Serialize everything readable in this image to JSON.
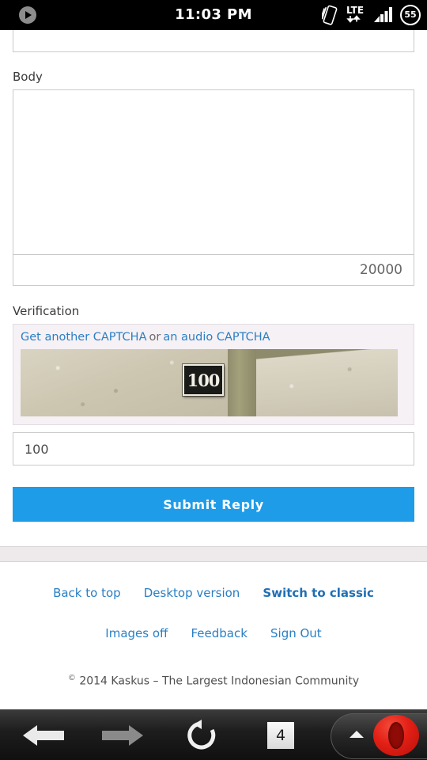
{
  "status_bar": {
    "play_icon": "play-circle-icon",
    "clock": "11:03 PM",
    "vibrate_icon": "vibrate-phone-icon",
    "network_label": "LTE",
    "data_arrows_icon": "data-transfer-arrows-icon",
    "signal_icon": "signal-bars-icon",
    "battery_level": "55"
  },
  "form": {
    "body_label": "Body",
    "body_value": "",
    "body_placeholder": "",
    "char_counter": "20000",
    "verification_label": "Verification",
    "captcha": {
      "get_another_link": "Get another CAPTCHA",
      "separator_text": "or",
      "audio_link": "an audio CAPTCHA",
      "image_alt": "captcha-street-number-photo",
      "image_number": "100"
    },
    "captcha_answer_value": "100",
    "captcha_answer_placeholder": "",
    "submit_label": "Submit Reply"
  },
  "footer": {
    "row1": [
      {
        "label": "Back to top",
        "bold": false
      },
      {
        "label": "Desktop version",
        "bold": false
      },
      {
        "label": "Switch to classic",
        "bold": true
      }
    ],
    "row2": [
      {
        "label": "Images off",
        "bold": false
      },
      {
        "label": "Feedback",
        "bold": false
      },
      {
        "label": "Sign Out",
        "bold": false
      }
    ],
    "copyright_mark": "©",
    "copyright_text": "2014 Kaskus  –  The Largest Indonesian Community"
  },
  "browser_bar": {
    "back_icon": "back-arrow-icon",
    "forward_icon": "forward-arrow-icon",
    "reload_icon": "reload-icon",
    "tab_count": "4",
    "menu_chevron_icon": "chevron-up-icon",
    "opera_logo_icon": "opera-logo-icon"
  },
  "colors": {
    "accent_blue": "#1e9ce8",
    "link_blue": "#2a7fc4",
    "opera_red": "#e31f15",
    "separator_grey": "#eeeaec"
  }
}
